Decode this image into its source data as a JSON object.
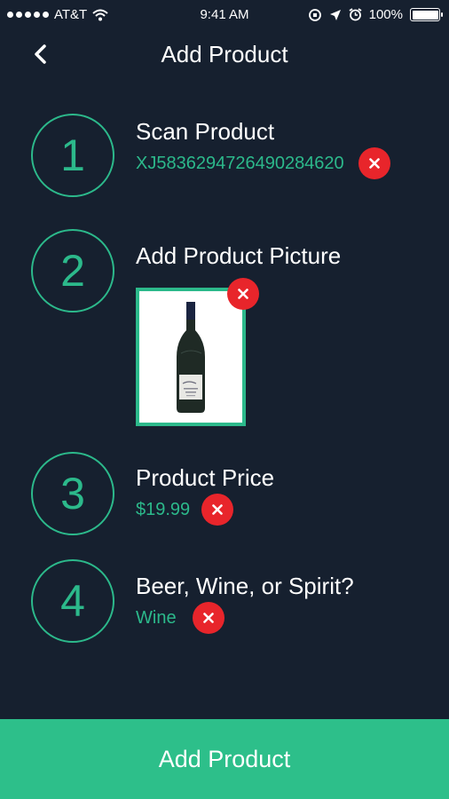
{
  "status_bar": {
    "carrier": "AT&T",
    "time": "9:41 AM",
    "battery": "100%"
  },
  "nav": {
    "title": "Add Product"
  },
  "steps": [
    {
      "number": "1",
      "title": "Scan Product",
      "value": "XJ5836294726490284620"
    },
    {
      "number": "2",
      "title": "Add Product Picture"
    },
    {
      "number": "3",
      "title": "Product Price",
      "value": "$19.99"
    },
    {
      "number": "4",
      "title": "Beer, Wine, or Spirit?",
      "value": "Wine"
    }
  ],
  "footer": {
    "button_label": "Add Product"
  },
  "colors": {
    "background": "#16202f",
    "accent": "#2cb98b",
    "remove": "#e8252b",
    "button": "#2dbf8a"
  }
}
